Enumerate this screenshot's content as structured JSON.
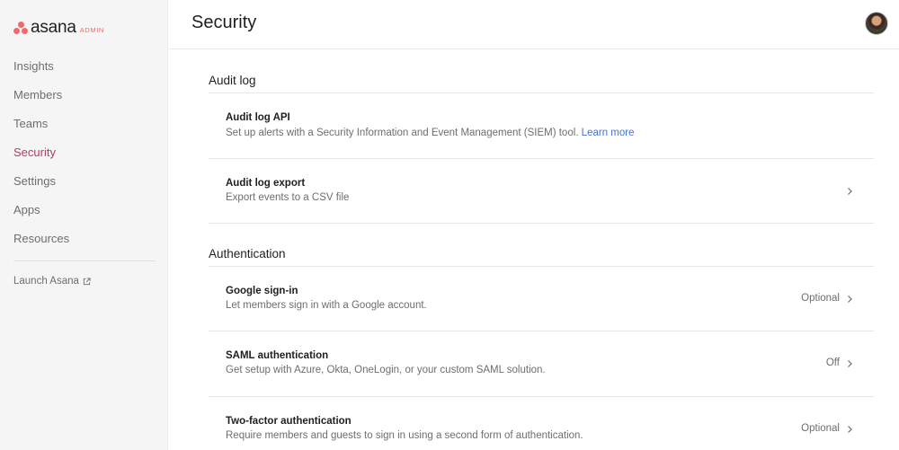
{
  "brand": {
    "name": "asana",
    "badge": "ADMIN",
    "dot_color": "#f06a6a"
  },
  "sidebar": {
    "items": [
      {
        "label": "Insights",
        "active": false
      },
      {
        "label": "Members",
        "active": false
      },
      {
        "label": "Teams",
        "active": false
      },
      {
        "label": "Security",
        "active": true
      },
      {
        "label": "Settings",
        "active": false
      },
      {
        "label": "Apps",
        "active": false
      },
      {
        "label": "Resources",
        "active": false
      }
    ],
    "launch_label": "Launch Asana",
    "launch_icon": "external-link-icon",
    "active_color": "#b13d64"
  },
  "header": {
    "title": "Security",
    "avatar_icon": "user-avatar"
  },
  "sections": {
    "audit": {
      "title": "Audit log",
      "rows": [
        {
          "title": "Audit log API",
          "desc": "Set up alerts with a Security Information and Event Management (SIEM) tool.",
          "link": "Learn more"
        },
        {
          "title": "Audit log export",
          "desc": "Export events to a CSV file",
          "chevron": "chevron-right-icon"
        }
      ]
    },
    "auth": {
      "title": "Authentication",
      "rows": [
        {
          "title": "Google sign-in",
          "desc": "Let members sign in with a Google account.",
          "status": "Optional",
          "chevron": "chevron-right-icon"
        },
        {
          "title": "SAML authentication",
          "desc": "Get setup with Azure, Okta, OneLogin, or your custom SAML solution.",
          "status": "Off",
          "chevron": "chevron-right-icon"
        },
        {
          "title": "Two-factor authentication",
          "desc": "Require members and guests to sign in using a second form of authentication.",
          "status": "Optional",
          "chevron": "chevron-right-icon"
        }
      ]
    }
  },
  "colors": {
    "link": "#4573d2"
  }
}
